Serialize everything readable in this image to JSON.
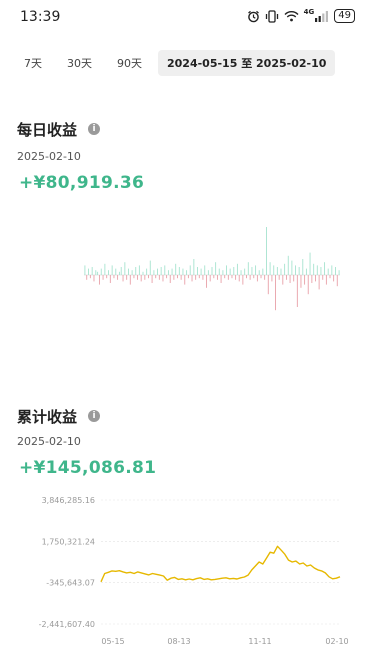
{
  "status_bar": {
    "time": "13:39",
    "network": "4G",
    "battery": "49",
    "icons": [
      "alarm-icon",
      "vibrate-icon",
      "wifi-icon",
      "signal-icon",
      "battery-icon"
    ]
  },
  "range_tabs": [
    {
      "label": "7天"
    },
    {
      "label": "30天"
    },
    {
      "label": "90天"
    },
    {
      "label": "2024-05-15 至 2025-02-10",
      "selected": true
    }
  ],
  "daily": {
    "title": "每日收益",
    "date": "2025-02-10",
    "amount": "+¥80,919.36"
  },
  "cumulative": {
    "title": "累计收益",
    "date": "2025-02-10",
    "amount": "+¥145,086.81"
  },
  "colors": {
    "positive": "#3fb68b",
    "negative": "#d9534f",
    "pos_bar": "#a6e3cf",
    "neg_bar": "#e8a0a8",
    "line": "#e6b800"
  },
  "chart_data": [
    {
      "type": "bar",
      "title": "每日收益",
      "note": "daily profit bars around zero baseline",
      "values": [
        6,
        -3,
        4,
        -2,
        5,
        -4,
        3,
        2,
        -6,
        4,
        -3,
        7,
        -2,
        3,
        -5,
        6,
        -2,
        4,
        -3,
        2,
        5,
        -4,
        8,
        -3,
        4,
        -6,
        3,
        -2,
        5,
        -3,
        6,
        -4,
        2,
        -3,
        4,
        -2,
        9,
        -5,
        3,
        -2,
        4,
        -3,
        5,
        -4,
        6,
        -2,
        3,
        -5,
        4,
        -3,
        7,
        -2,
        5,
        -3,
        4,
        -6,
        3,
        -2,
        6,
        -4,
        10,
        -3,
        5,
        -2,
        4,
        -3,
        6,
        -8,
        3,
        -4,
        5,
        -2,
        8,
        -3,
        4,
        -5,
        3,
        -2,
        6,
        -3,
        4,
        -2,
        5,
        -3,
        7,
        -4,
        3,
        -6,
        4,
        -2,
        8,
        -3,
        5,
        -2,
        6,
        -4,
        3,
        -2,
        4,
        -3,
        30,
        -12,
        8,
        -4,
        6,
        -22,
        5,
        -3,
        4,
        -6,
        7,
        -3,
        12,
        -5,
        9,
        -4,
        6,
        -20,
        5,
        -8,
        10,
        -6,
        4,
        -12,
        14,
        -5,
        7,
        -4,
        6,
        -9,
        5,
        -3,
        8,
        -6,
        4,
        -2,
        6,
        -4,
        5,
        -7,
        3
      ]
    },
    {
      "type": "line",
      "title": "累计收益",
      "yticks": [
        "3,846,285.16",
        "1,750,321.24",
        "-345,643.07",
        "-2,441,607.40"
      ],
      "xticks": [
        "05-15",
        "08-13",
        "11-11",
        "02-10"
      ],
      "ylim": [
        -2441607.4,
        3846285.16
      ],
      "values": [
        -300000,
        120000,
        180000,
        250000,
        230000,
        260000,
        200000,
        150000,
        180000,
        120000,
        200000,
        150000,
        100000,
        50000,
        120000,
        80000,
        40000,
        -10000,
        -220000,
        -120000,
        -80000,
        -180000,
        -150000,
        -200000,
        -160000,
        -200000,
        -140000,
        -100000,
        -180000,
        -150000,
        -200000,
        -180000,
        -150000,
        -120000,
        -100000,
        -150000,
        -130000,
        -160000,
        -100000,
        -60000,
        40000,
        300000,
        500000,
        700000,
        600000,
        900000,
        1200000,
        1150000,
        1500000,
        1300000,
        1100000,
        800000,
        700000,
        750000,
        600000,
        650000,
        500000,
        550000,
        400000,
        300000,
        250000,
        150000,
        -50000,
        -150000,
        -120000,
        -50000
      ]
    }
  ]
}
